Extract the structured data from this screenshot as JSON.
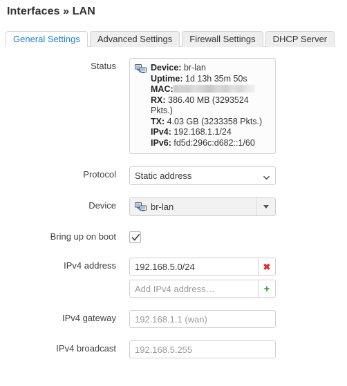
{
  "page": {
    "title": "Interfaces » LAN"
  },
  "tabs": [
    {
      "label": "General Settings",
      "active": true
    },
    {
      "label": "Advanced Settings",
      "active": false
    },
    {
      "label": "Firewall Settings",
      "active": false
    },
    {
      "label": "DHCP Server",
      "active": false
    }
  ],
  "form": {
    "status": {
      "label": "Status",
      "icon": "network-device-icon",
      "rows": [
        {
          "key": "Device:",
          "value": "br-lan"
        },
        {
          "key": "Uptime:",
          "value": "1d 13h 35m 50s"
        },
        {
          "key": "MAC:",
          "value": "",
          "redacted": true
        },
        {
          "key": "RX:",
          "value": "386.40 MB (3293524 Pkts.)"
        },
        {
          "key": "TX:",
          "value": "4.03 GB (3233358 Pkts.)"
        },
        {
          "key": "IPv4:",
          "value": "192.168.1.1/24"
        },
        {
          "key": "IPv6:",
          "value": "fd5d:296c:d682::1/60"
        }
      ]
    },
    "protocol": {
      "label": "Protocol",
      "value": "Static address",
      "options": [
        "Static address"
      ]
    },
    "device": {
      "label": "Device",
      "value": "br-lan",
      "icon": "network-device-icon"
    },
    "bring_up_on_boot": {
      "label": "Bring up on boot",
      "checked": true
    },
    "ipv4_address": {
      "label": "IPv4 address",
      "value": "192.168.5.0/24",
      "remove_label": "✖",
      "add_placeholder": "Add IPv4 address…",
      "add_value": "",
      "add_label": "+"
    },
    "ipv4_gateway": {
      "label": "IPv4 gateway",
      "value": "",
      "placeholder": "192.168.1.1 (wan)"
    },
    "ipv4_broadcast": {
      "label": "IPv4 broadcast",
      "value": "",
      "placeholder": "192.168.5.255"
    }
  },
  "colors": {
    "active_tab_text": "#1a7fd4",
    "remove_button": "#d9342b",
    "add_button": "#29a329",
    "border": "#d4d4d4"
  }
}
